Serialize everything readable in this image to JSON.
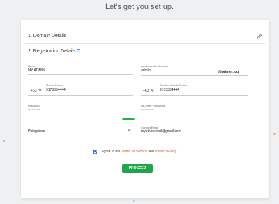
{
  "page": {
    "heading": "Let's get you set up."
  },
  "sections": {
    "domain": {
      "title": "1. Domain Details"
    },
    "registration": {
      "title": "2. Registration Details"
    }
  },
  "form": {
    "name": {
      "label": "Name",
      "value": "MY ADMIN"
    },
    "admin_account": {
      "label": "Administrator Account",
      "value": "admin",
      "suffix": "@printer.icu"
    },
    "mobile_phone": {
      "label": "Mobile Phone",
      "country_code": "+63",
      "value": "9173334444"
    },
    "confirm_mobile_phone": {
      "label": "Confirm Mobile Phone",
      "country_code": "+63",
      "value": "9173334444"
    },
    "password": {
      "label": "Password",
      "value": "••••••••••"
    },
    "reenter_password": {
      "label": "Re-enter Password",
      "value": "••••••••••"
    },
    "country": {
      "value": "Philippines"
    },
    "contact_email": {
      "label": "Contact Email",
      "value": "myotheremail@gmail.com"
    },
    "password_strength": 1.0
  },
  "agreement": {
    "checked": true,
    "prefix": "I agree to the ",
    "tos_link": "Terms of Service",
    "middle": " and ",
    "privacy_link": "Privacy Policy",
    "suffix": "."
  },
  "actions": {
    "proceed_label": "PROCEED"
  },
  "colors": {
    "accent_green": "#1fa64a",
    "link_red": "#e4572e",
    "check_blue": "#2a7ae2"
  }
}
